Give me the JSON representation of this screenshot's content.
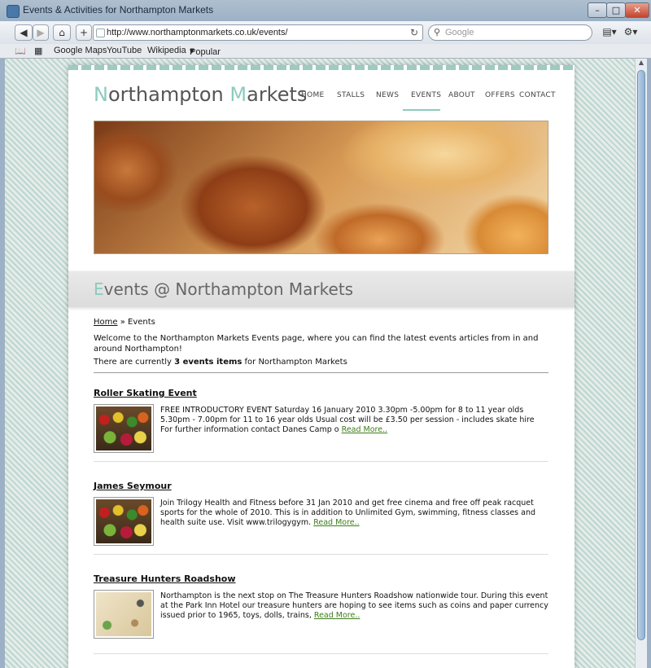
{
  "window": {
    "title": "Events & Activities for Northampton Markets"
  },
  "browser": {
    "url": "http://www.northamptonmarkets.co.uk/events/",
    "search_placeholder": "Google",
    "bookmarks": [
      "Google Maps",
      "YouTube",
      "Wikipedia",
      "Popular"
    ]
  },
  "site": {
    "logo_first": "N",
    "logo_mid": "orthampton ",
    "logo_accent2": "M",
    "logo_end": "arkets",
    "nav": [
      "HOME",
      "STALLS",
      "NEWS",
      "EVENTS",
      "ABOUT",
      "OFFERS",
      "CONTACT"
    ],
    "active_nav": "EVENTS",
    "accent_color": "#8ecabd"
  },
  "page": {
    "heading_accent": "E",
    "heading_rest": "vents @ Northampton Markets",
    "breadcrumb_home": "Home",
    "breadcrumb_sep": " » ",
    "breadcrumb_current": "Events",
    "intro": "Welcome to the Northampton Markets Events page, where you can find the latest events articles from in and around Northampton!",
    "count_prefix": "There are currently ",
    "count_bold": "3 events items",
    "count_suffix": " for Northampton Markets"
  },
  "events": [
    {
      "title": "Roller Skating Event",
      "text": "FREE INTRODUCTORY EVENT Saturday 16 January 2010 3.30pm -5.00pm for 8 to 11 year olds 5.30pm - 7.00pm for 11 to 16 year olds Usual cost will be £3.50 per session - includes skate hire For further information contact Danes Camp o ",
      "link": "Read More..",
      "image": "fruit-stall"
    },
    {
      "title": "James Seymour",
      "text": "Join Trilogy Health and Fitness before 31 Jan 2010 and get free cinema and free off peak racquet sports for the whole of 2010. This is in addition to Unlimited Gym, swimming, fitness classes and health suite use. Visit www.trilogygym. ",
      "link": "Read More..",
      "image": "fruit-stall"
    },
    {
      "title": "Treasure Hunters Roadshow",
      "text": "Northampton is the next stop on The Treasure Hunters Roadshow nationwide tour. During this event at the Park Inn Hotel our treasure hunters are hoping to see items such as coins and paper currency issued prior to 1965, toys, dolls, trains, ",
      "link": "Read More..",
      "image": "treasure-map"
    }
  ]
}
